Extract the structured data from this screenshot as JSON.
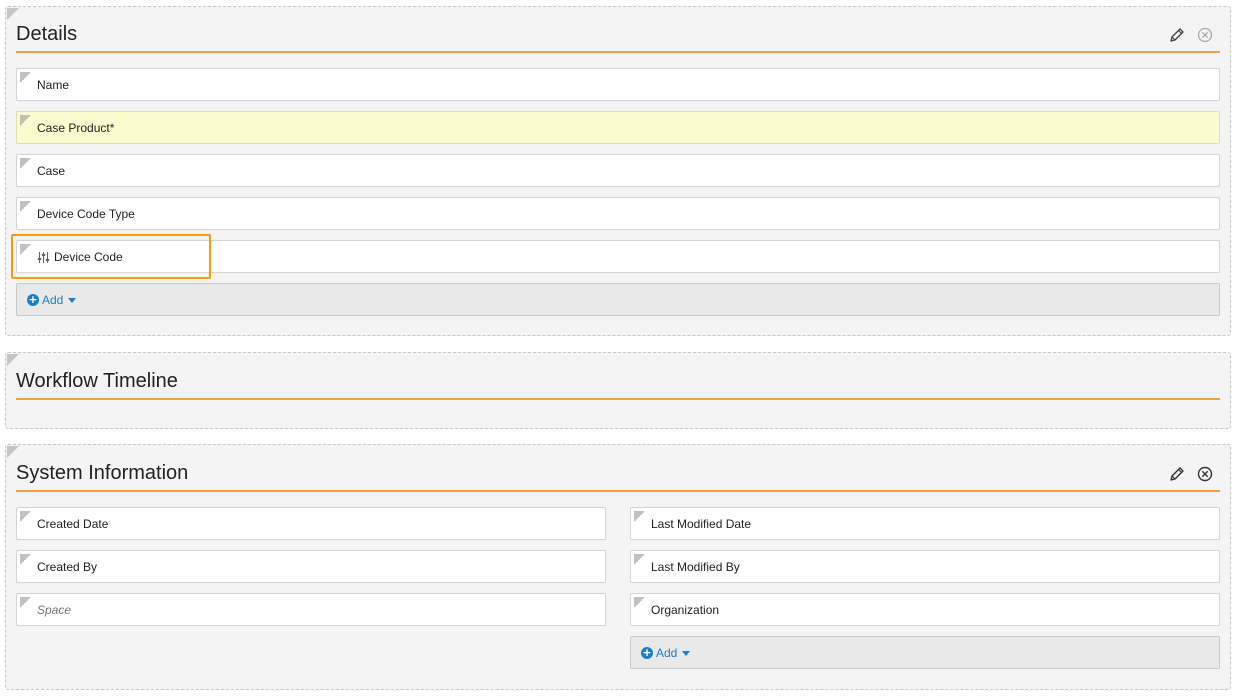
{
  "details": {
    "title": "Details",
    "fields": [
      {
        "label": "Name",
        "required": false
      },
      {
        "label": "Case Product*",
        "required": true
      },
      {
        "label": "Case",
        "required": false
      },
      {
        "label": "Device Code Type",
        "required": false
      },
      {
        "label": "Device Code",
        "required": false,
        "has_icon": true
      }
    ],
    "add_label": "Add"
  },
  "workflow": {
    "title": "Workflow Timeline"
  },
  "system_info": {
    "title": "System Information",
    "left_fields": [
      {
        "label": "Created Date"
      },
      {
        "label": "Created By"
      },
      {
        "label": "Space",
        "placeholder_style": true
      }
    ],
    "right_fields": [
      {
        "label": "Last Modified Date"
      },
      {
        "label": "Last Modified By"
      },
      {
        "label": "Organization"
      }
    ],
    "add_label": "Add"
  },
  "colors": {
    "accent_rule": "#f0a040",
    "highlight": "#f39c12",
    "link": "#1a7ec8",
    "required_bg": "#fbfbd0"
  }
}
